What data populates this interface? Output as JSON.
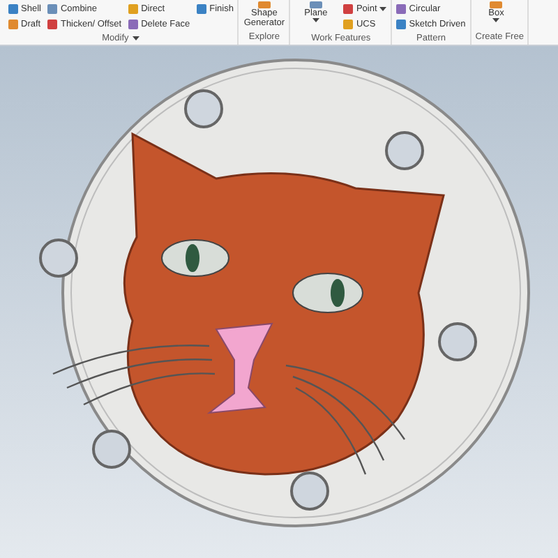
{
  "ribbon": {
    "groups": [
      {
        "label": "Modify",
        "dropdown": true,
        "columns": [
          [
            {
              "label": "Shell",
              "kind": "small",
              "caret": false
            },
            {
              "label": "Draft",
              "kind": "small",
              "caret": false
            }
          ],
          [
            {
              "label": "Combine",
              "kind": "small",
              "caret": false
            },
            {
              "label": "Thicken/ Offset",
              "kind": "small",
              "caret": false
            }
          ],
          [
            {
              "label": "Direct",
              "kind": "small",
              "caret": false
            },
            {
              "label": "Delete Face",
              "kind": "small",
              "caret": false
            }
          ],
          [
            {
              "label": "Finish",
              "kind": "small",
              "caret": false
            }
          ]
        ]
      },
      {
        "label": "Explore",
        "columns": [
          [
            {
              "label": "Shape Generator",
              "kind": "large",
              "caret": false
            }
          ]
        ]
      },
      {
        "label": "Work Features",
        "columns": [
          [
            {
              "label": "Plane",
              "kind": "large",
              "caret": true
            }
          ],
          [
            {
              "label": "Point",
              "kind": "small",
              "caret": true
            },
            {
              "label": "UCS",
              "kind": "small",
              "caret": false
            }
          ]
        ]
      },
      {
        "label": "Pattern",
        "columns": [
          [
            {
              "label": "Circular",
              "kind": "small",
              "caret": false
            },
            {
              "label": "Sketch Driven",
              "kind": "small",
              "caret": false
            }
          ]
        ]
      },
      {
        "label": "Create Free",
        "columns": [
          [
            {
              "label": "Box",
              "kind": "large",
              "caret": true
            }
          ]
        ]
      }
    ]
  }
}
